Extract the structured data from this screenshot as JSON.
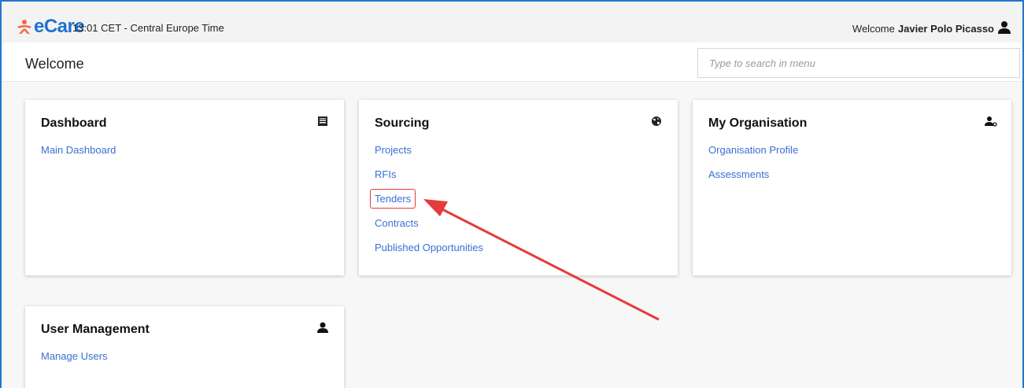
{
  "header": {
    "logo_text": "eCare",
    "time": "13:01 CET - Central Europe Time",
    "welcome_prefix": "Welcome",
    "user_name": "Javier Polo Picasso"
  },
  "titlebar": {
    "title": "Welcome",
    "search_placeholder": "Type to search in menu"
  },
  "cards": {
    "dashboard": {
      "title": "Dashboard",
      "links": [
        "Main Dashboard"
      ]
    },
    "sourcing": {
      "title": "Sourcing",
      "links": [
        "Projects",
        "RFIs",
        "Tenders",
        "Contracts",
        "Published Opportunities"
      ]
    },
    "organisation": {
      "title": "My Organisation",
      "links": [
        "Organisation Profile",
        "Assessments"
      ]
    },
    "users": {
      "title": "User Management",
      "links": [
        "Manage Users"
      ]
    }
  },
  "colors": {
    "brand": "#1f73d0",
    "link": "#3b6fd3",
    "highlight": "#e53b3b"
  }
}
